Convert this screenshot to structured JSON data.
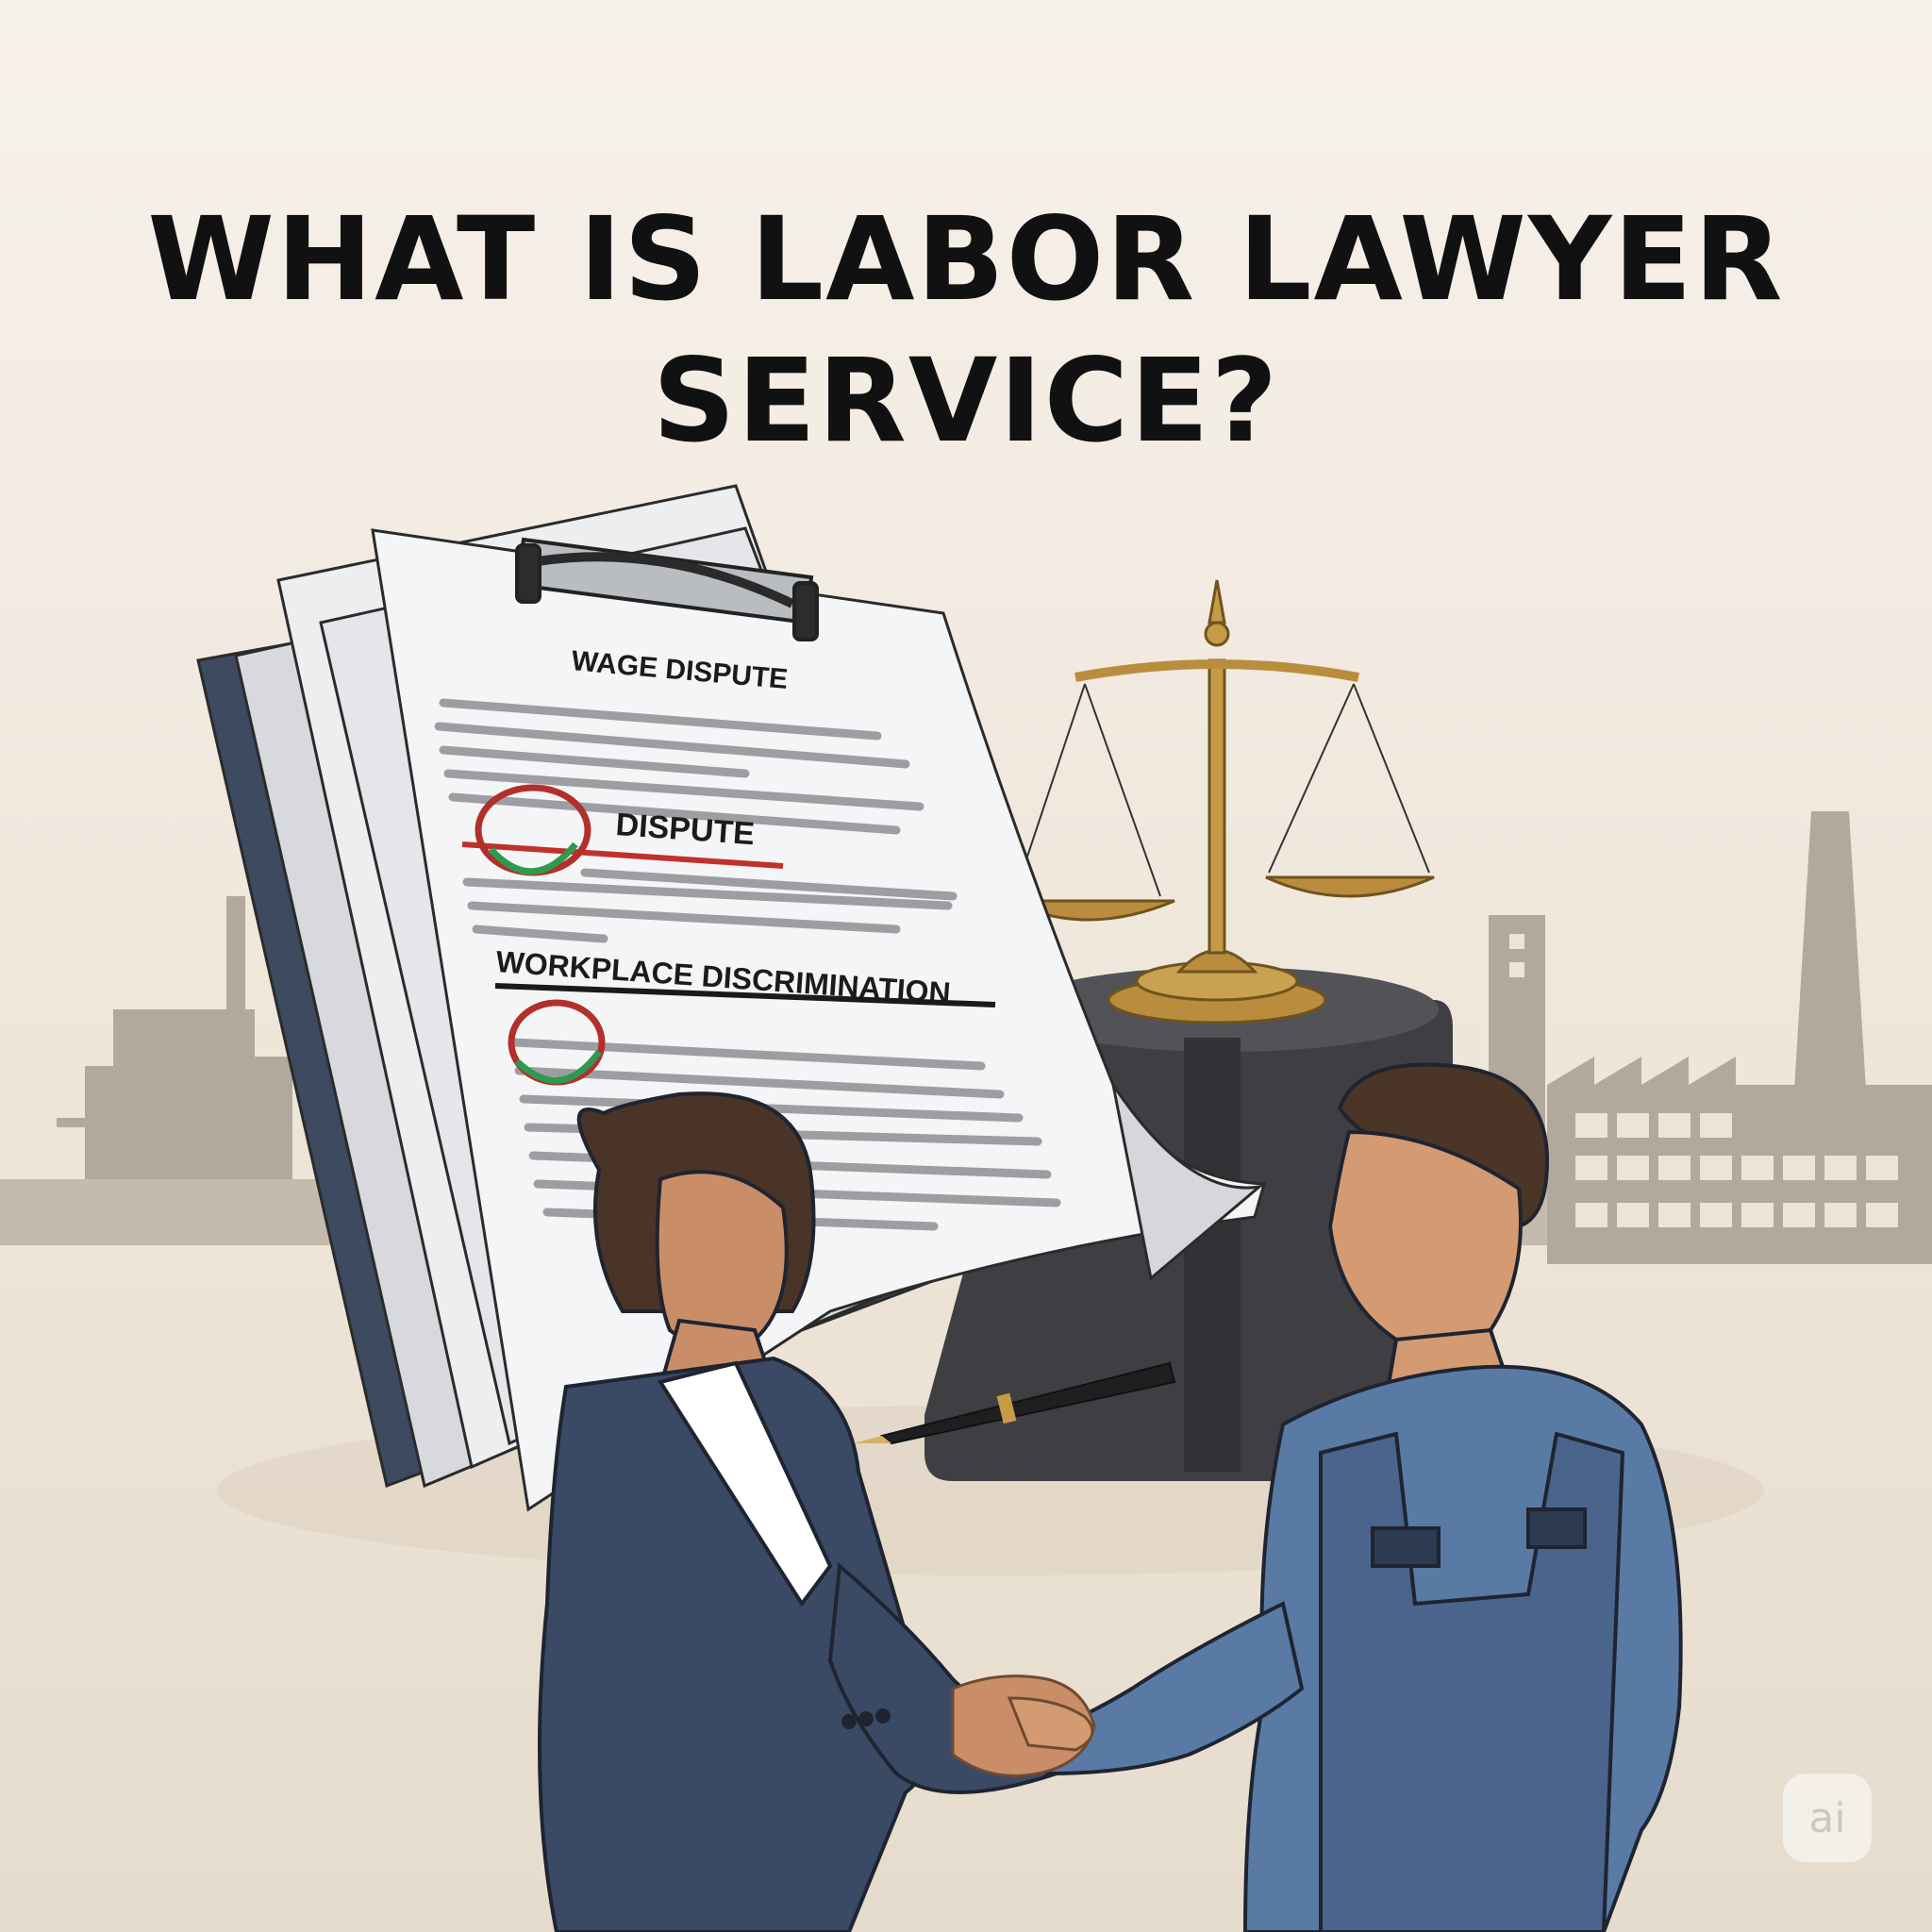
{
  "title": {
    "line1": "WHAT IS LABOR LAWYER",
    "line2": "SERVICE?"
  },
  "document": {
    "heading": "WAGE DISPUTE",
    "item1": "DISPUTE",
    "item2": "WORKPLACE DISCRIMINATION"
  },
  "badge": {
    "label": "ai"
  },
  "colors": {
    "background": "#efe7dc",
    "factory": "#b3a89c",
    "suit": "#3a4a65",
    "overalls": "#4f6a92",
    "gold": "#b98d3d",
    "red_circle": "#b2302c",
    "green_mark": "#2f9a4f"
  },
  "icons": [
    "scales-of-justice-icon",
    "clipboard-clip-icon",
    "fountain-pen-icon",
    "factory-skyline-icon",
    "handshake-icon"
  ]
}
